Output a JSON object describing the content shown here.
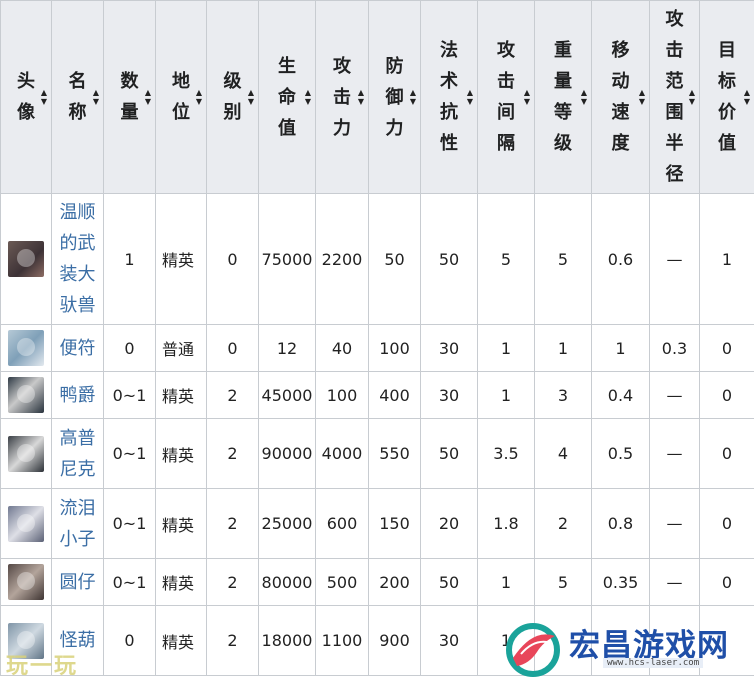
{
  "headers": [
    "头像",
    "名称",
    "数量",
    "地位",
    "级别",
    "生命值",
    "攻击力",
    "防御力",
    "法术抗性",
    "攻击间隔",
    "重量等级",
    "移动速度",
    "攻击范围半径",
    "目标价值"
  ],
  "sort_icon": "sort-arrows-icon",
  "rows": [
    {
      "avatar": "avatar-1",
      "name": "温顺的武装大驮兽",
      "count": "1",
      "rank": "精英",
      "level": "0",
      "hp": "75000",
      "atk": "2200",
      "def": "50",
      "res": "50",
      "interval": "5",
      "weight": "5",
      "speed": "0.6",
      "range": "—",
      "target": "1"
    },
    {
      "avatar": "avatar-2",
      "name": "便符",
      "count": "0",
      "rank": "普通",
      "level": "0",
      "hp": "12",
      "atk": "40",
      "def": "100",
      "res": "30",
      "interval": "1",
      "weight": "1",
      "speed": "1",
      "range": "0.3",
      "target": "0"
    },
    {
      "avatar": "avatar-3",
      "name": "鸭爵",
      "count": "0~1",
      "rank": "精英",
      "level": "2",
      "hp": "45000",
      "atk": "100",
      "def": "400",
      "res": "30",
      "interval": "1",
      "weight": "3",
      "speed": "0.4",
      "range": "—",
      "target": "0"
    },
    {
      "avatar": "avatar-4",
      "name": "高普尼克",
      "count": "0~1",
      "rank": "精英",
      "level": "2",
      "hp": "90000",
      "atk": "4000",
      "def": "550",
      "res": "50",
      "interval": "3.5",
      "weight": "4",
      "speed": "0.5",
      "range": "—",
      "target": "0"
    },
    {
      "avatar": "avatar-5",
      "name": "流泪小子",
      "count": "0~1",
      "rank": "精英",
      "level": "2",
      "hp": "25000",
      "atk": "600",
      "def": "150",
      "res": "20",
      "interval": "1.8",
      "weight": "2",
      "speed": "0.8",
      "range": "—",
      "target": "0"
    },
    {
      "avatar": "avatar-6",
      "name": "圆仔",
      "count": "0~1",
      "rank": "精英",
      "level": "2",
      "hp": "80000",
      "atk": "500",
      "def": "200",
      "res": "50",
      "interval": "1",
      "weight": "5",
      "speed": "0.35",
      "range": "—",
      "target": "0"
    },
    {
      "avatar": "avatar-7",
      "name": "怪葫",
      "count": "0",
      "rank": "精英",
      "level": "2",
      "hp": "18000",
      "atk": "1100",
      "def": "900",
      "res": "30",
      "interval": "1",
      "weight": "",
      "speed": "",
      "range": "",
      "target": ""
    }
  ],
  "watermark_left": "玩一玩",
  "watermark_right": {
    "title": "宏昌游戏网",
    "url": "www.hcs-laser.com"
  }
}
